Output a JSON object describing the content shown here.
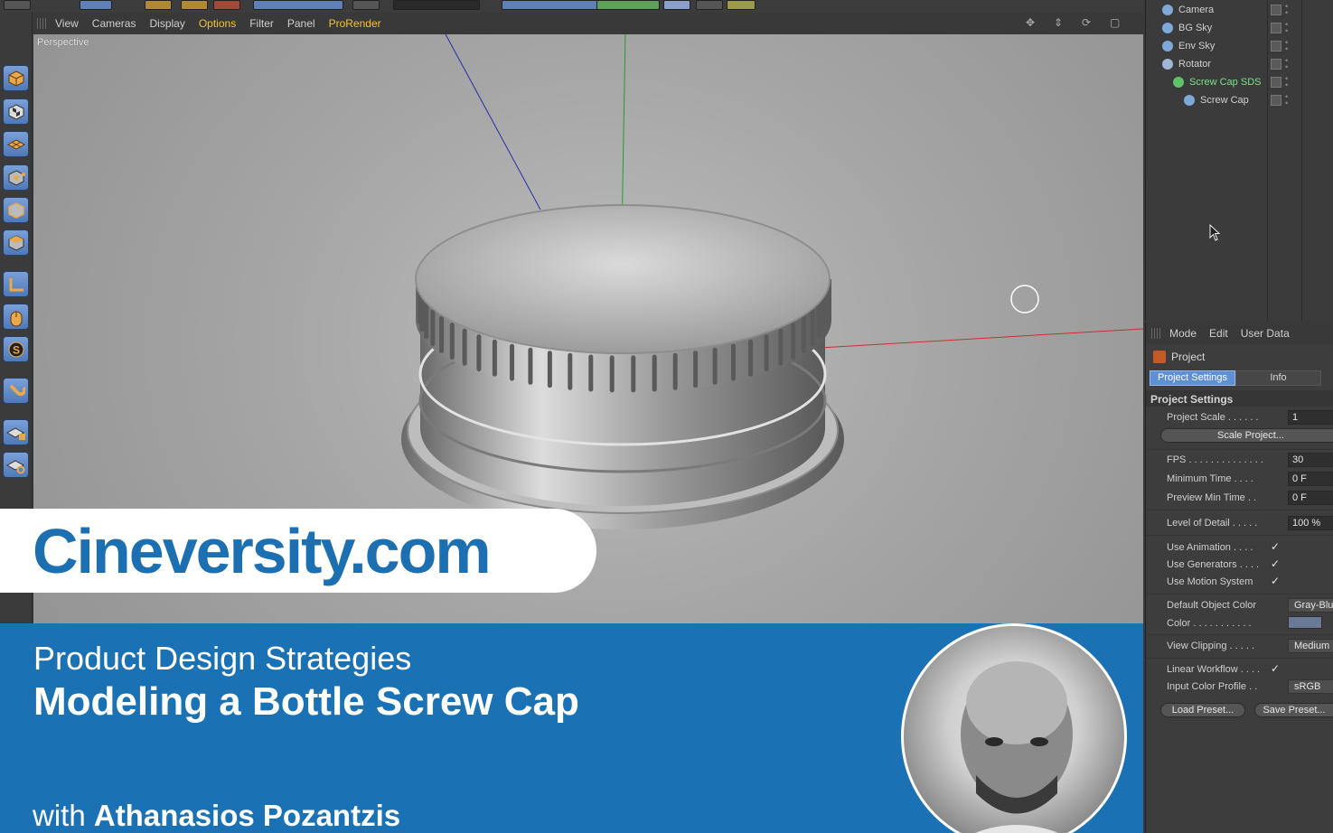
{
  "viewport": {
    "menu": [
      "View",
      "Cameras",
      "Display",
      "Options",
      "Filter",
      "Panel",
      "ProRender"
    ],
    "label": "Perspective"
  },
  "objects": [
    {
      "name": "Camera",
      "icon_color": "#7fa9d9"
    },
    {
      "name": "BG Sky",
      "icon_color": "#7fa9d9"
    },
    {
      "name": "Env Sky",
      "icon_color": "#7fa9d9"
    },
    {
      "name": "Rotator",
      "icon_color": "#9fb7d6"
    },
    {
      "name": "Screw Cap SDS",
      "icon_color": "#5fc36a",
      "selected": true
    },
    {
      "name": "Screw Cap",
      "icon_color": "#7fa9d9"
    }
  ],
  "attributes": {
    "menu": [
      "Mode",
      "Edit",
      "User Data"
    ],
    "object": "Project",
    "tabs": [
      "Project Settings",
      "Info"
    ],
    "section": "Project Settings",
    "project_scale_label": "Project Scale . . . . . .",
    "project_scale": "1",
    "scale_button": "Scale Project...",
    "fps_label": "FPS . . . . . . . . . . . . . .",
    "fps": "30",
    "min_time_label": "Minimum Time . . . .",
    "min_time": "0 F",
    "preview_min_label": "Preview Min Time . .",
    "preview_min": "0 F",
    "lod_label": "Level of Detail . . . . .",
    "lod": "100 %",
    "use_animation_label": "Use Animation . . . .",
    "use_generators_label": "Use Generators . . . .",
    "use_motion_label": "Use Motion System",
    "default_color_label": "Default Object Color",
    "default_color": "Gray-Blue",
    "color_label": "Color . . . . . . . . . . .",
    "view_clipping_label": "View Clipping . . . . .",
    "view_clipping": "Medium",
    "linear_workflow_label": "Linear Workflow . . . .",
    "input_profile_label": "Input Color Profile . .",
    "input_profile": "sRGB",
    "load_preset": "Load Preset...",
    "save_preset": "Save Preset...",
    "check": "✓"
  },
  "branding": {
    "site": "Cineversity.com",
    "series": "Product Design Strategies",
    "title": "Modeling a Bottle Screw Cap",
    "with": "with",
    "author": "Athanasios Pozantzis"
  },
  "colors": {
    "accent_blue": "#1a72b4",
    "brand_blue": "#1c6fb0",
    "highlight": "#f2c340"
  }
}
